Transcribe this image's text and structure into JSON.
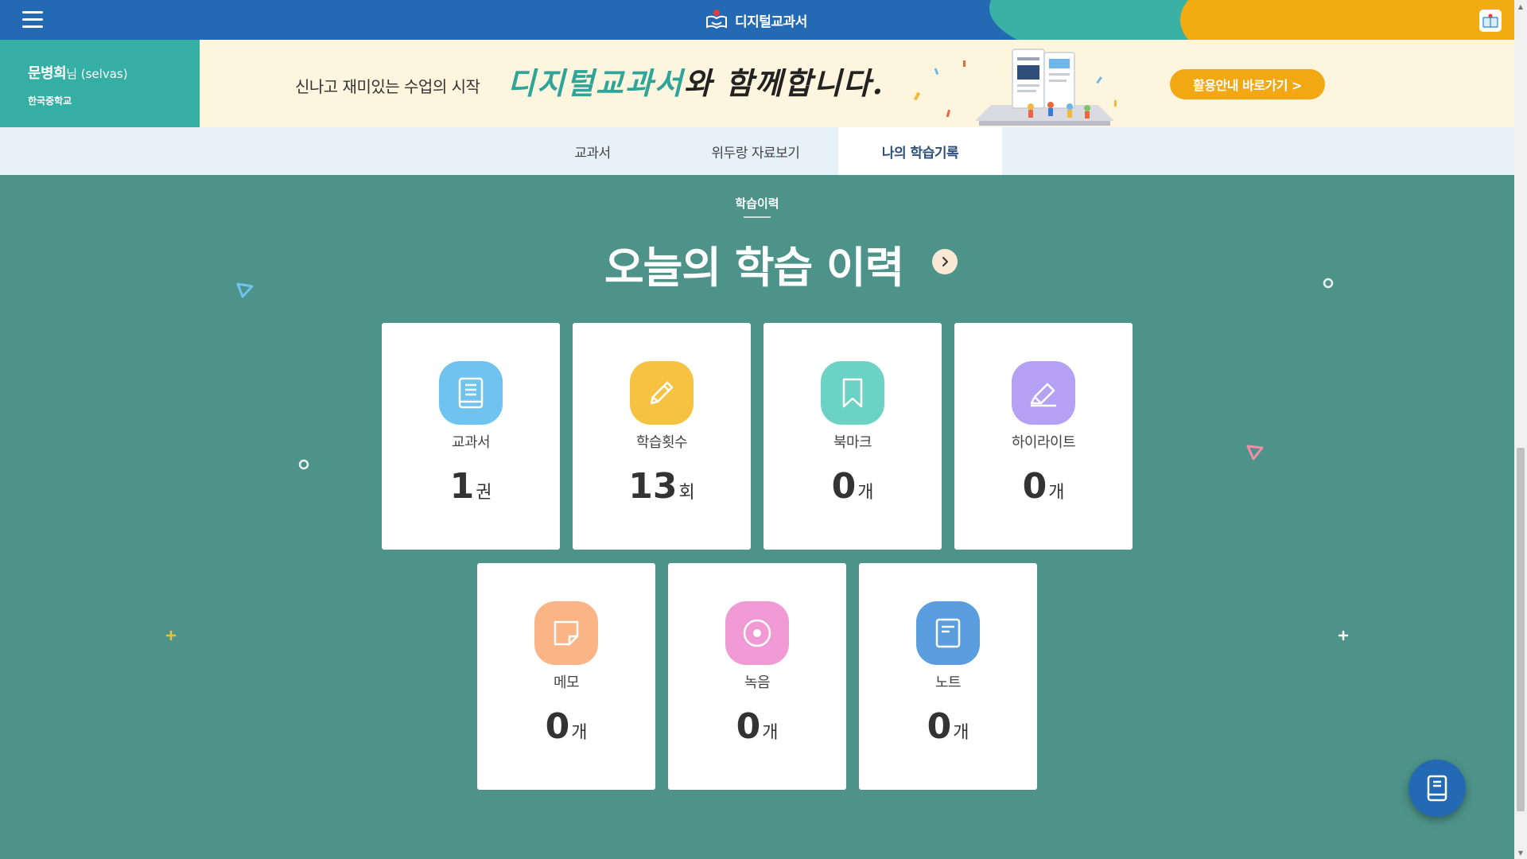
{
  "header": {
    "brand": "디지털교과서",
    "menu_icon": "hamburger-menu-icon",
    "viewer_icon": "textbook-viewer-icon"
  },
  "user": {
    "name": "문병희",
    "suffix": "님 (selvas)",
    "school": "한국중학교"
  },
  "banner": {
    "lead": "신나고 재미있는 수업의 시작",
    "headline_em": "디지털교과서",
    "headline_rest": "와 함께합니다.",
    "cta": "활용안내 바로가기 >"
  },
  "tabs": [
    {
      "label": "교과서",
      "active": false
    },
    {
      "label": "위두랑 자료보기",
      "active": false
    },
    {
      "label": "나의 학습기록",
      "active": true
    }
  ],
  "section": {
    "label": "학습이력",
    "title": "오늘의 학습 이력"
  },
  "cards": [
    {
      "label": "교과서",
      "value": "1",
      "unit": "권",
      "icon": "book-icon",
      "color": "#6fc3ee"
    },
    {
      "label": "학습횟수",
      "value": "13",
      "unit": "회",
      "icon": "pencil-icon",
      "color": "#f5c242"
    },
    {
      "label": "북마크",
      "value": "0",
      "unit": "개",
      "icon": "bookmark-icon",
      "color": "#6cd2c3"
    },
    {
      "label": "하이라이트",
      "value": "0",
      "unit": "개",
      "icon": "highlighter-icon",
      "color": "#b4a1f3"
    },
    {
      "label": "메모",
      "value": "0",
      "unit": "개",
      "icon": "memo-icon",
      "color": "#fbb486"
    },
    {
      "label": "녹음",
      "value": "0",
      "unit": "개",
      "icon": "record-icon",
      "color": "#ef9ad4"
    },
    {
      "label": "노트",
      "value": "0",
      "unit": "개",
      "icon": "note-icon",
      "color": "#5a9ee0"
    }
  ],
  "colors": {
    "header": "#2369b4",
    "main_bg": "#4d9389",
    "accent_teal": "#35aea4",
    "accent_orange": "#f2a813"
  }
}
